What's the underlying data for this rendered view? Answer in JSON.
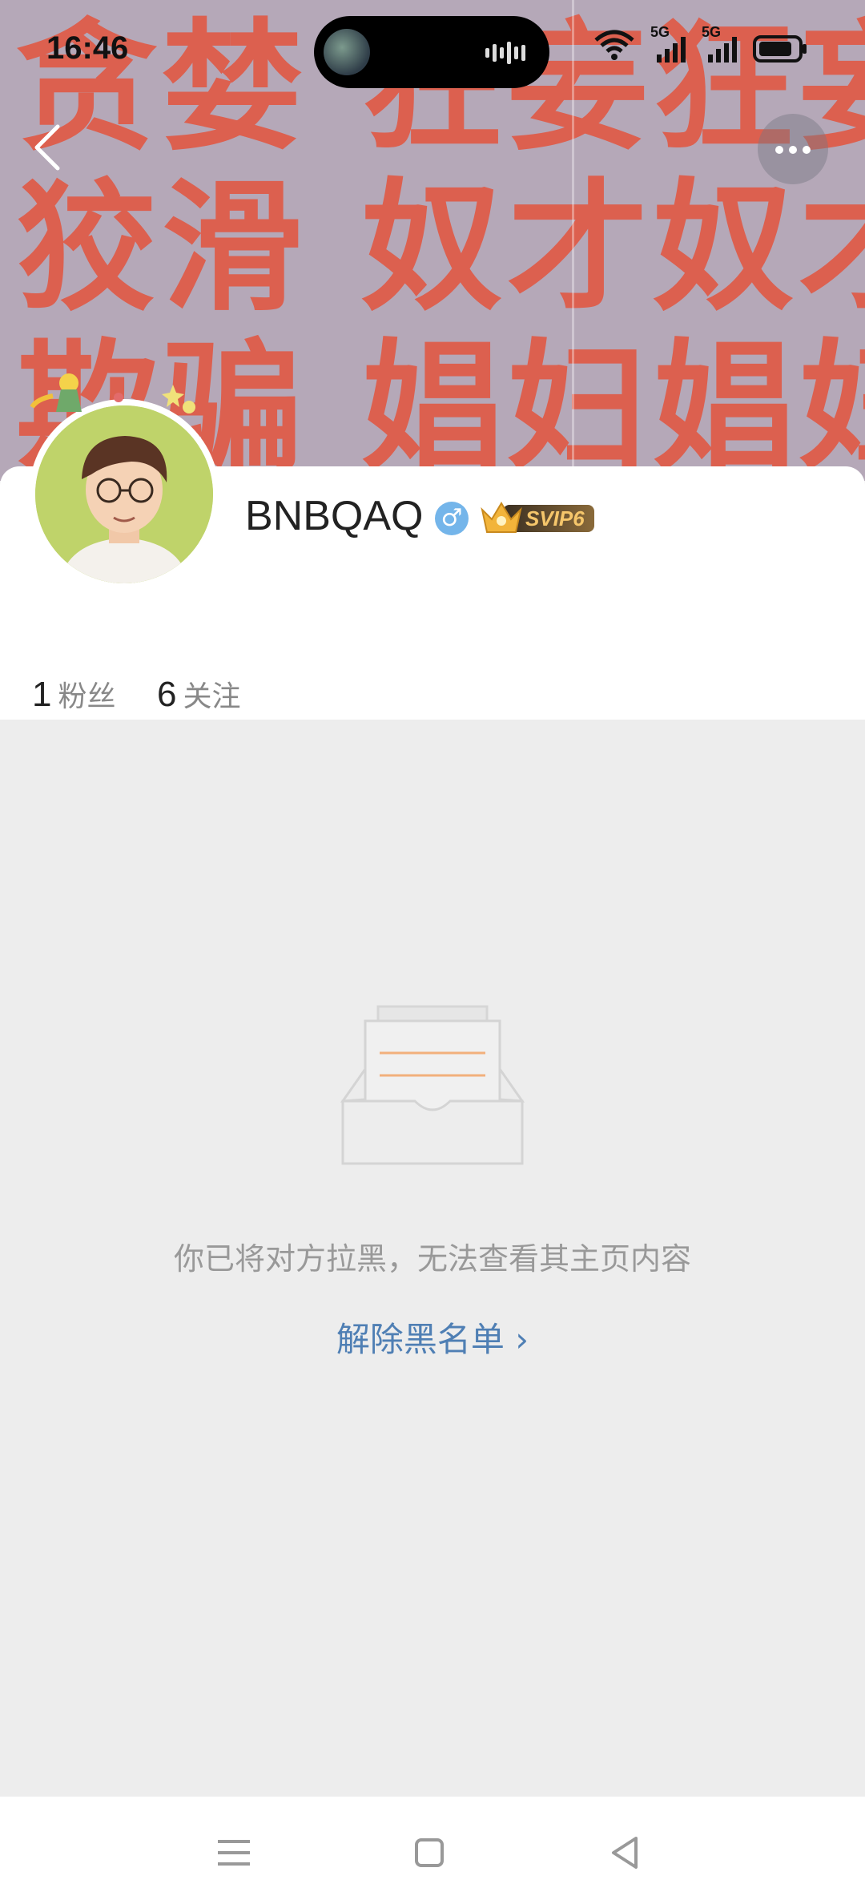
{
  "status_bar": {
    "time": "16:46",
    "network1": "5G",
    "network2": "5G"
  },
  "cover": {
    "text": "贪婪 狂妄狂妄\n狡滑 奴才奴才\n欺骗 娼妇娼妇"
  },
  "nav": {
    "back_icon": "chevron-left-icon",
    "more_icon": "more-icon"
  },
  "profile": {
    "username": "BNBQAQ",
    "gender_symbol": "♂",
    "vip_label": "SVIP6",
    "stats": [
      {
        "num": "1",
        "label": "粉丝"
      },
      {
        "num": "6",
        "label": "关注"
      }
    ]
  },
  "blocked": {
    "message": "你已将对方拉黑，无法查看其主页内容",
    "unblock_label": "解除黑名单 ›"
  },
  "colors": {
    "cover_text": "#e05a47",
    "link": "#4f7fb4",
    "gender_badge": "#74b5ea",
    "background": "#ededed"
  }
}
